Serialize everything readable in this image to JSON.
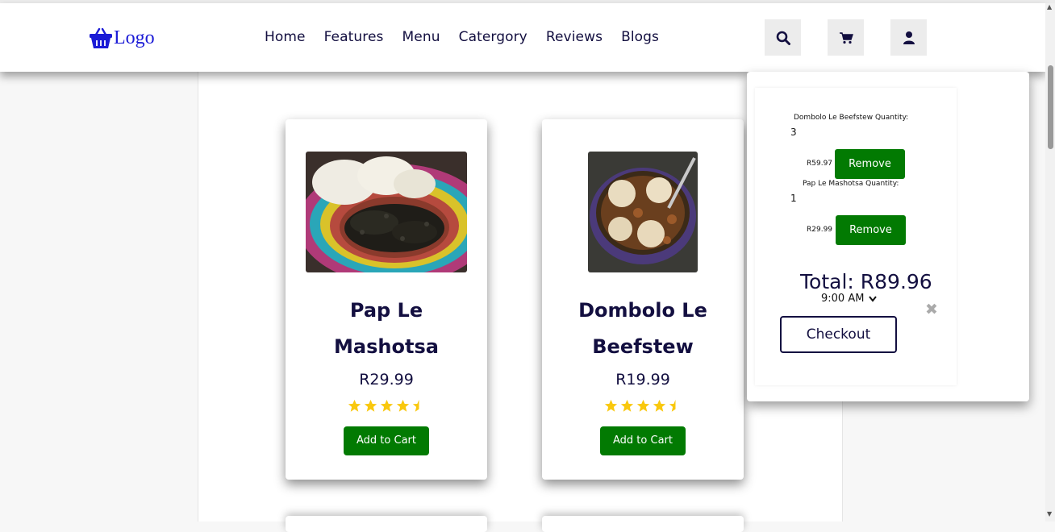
{
  "header": {
    "logo_text": "Logo",
    "nav": [
      "Home",
      "Features",
      "Menu",
      "Catergory",
      "Reviews",
      "Blogs"
    ],
    "icons": [
      "search-icon",
      "shopping-cart-icon",
      "user-icon"
    ]
  },
  "products": [
    {
      "name_line1": "Pap Le",
      "name_line2": "Mashotsa",
      "price": "R29.99",
      "rating": 4.5,
      "button": "Add to Cart",
      "image": "pap-with-mashotsa-photo"
    },
    {
      "name_line1": "Dombolo Le",
      "name_line2": "Beefstew",
      "price": "R19.99",
      "rating": 4.5,
      "button": "Add to Cart",
      "image": "dumplings-beef-stew-photo"
    }
  ],
  "cart": {
    "items": [
      {
        "label": "Dombolo Le Beefstew Quantity:",
        "quantity": "3",
        "price": "R59.97",
        "remove": "Remove"
      },
      {
        "label": "Pap Le Mashotsa Quantity:",
        "quantity": "1",
        "price": "R29.99",
        "remove": "Remove"
      }
    ],
    "total": "Total: R89.96",
    "time": "9:00 AM",
    "checkout": "Checkout",
    "close": "✖"
  },
  "colors": {
    "brand": "#130f40",
    "button_green": "#027a02",
    "star": "#f9c80e",
    "logo_blue": "#1b1bd6"
  }
}
